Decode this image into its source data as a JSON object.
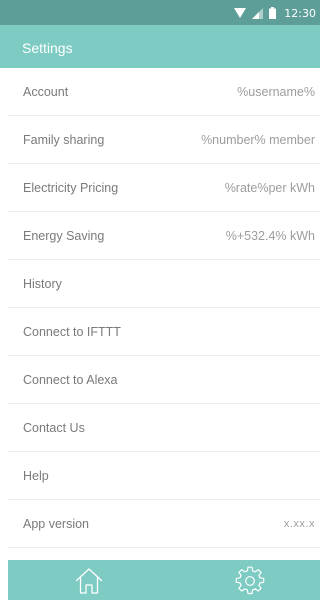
{
  "status_bar": {
    "time": "12:30",
    "icons": [
      "wifi-icon",
      "signal-icon",
      "battery-icon"
    ]
  },
  "header": {
    "title": "Settings"
  },
  "settings": {
    "items": [
      {
        "label": "Account",
        "value": "%username%"
      },
      {
        "label": "Family sharing",
        "value": "%number% member"
      },
      {
        "label": "Electricity Pricing",
        "value": "%rate%per kWh"
      },
      {
        "label": "Energy Saving",
        "value": "%+532.4% kWh"
      },
      {
        "label": "History",
        "value": ""
      },
      {
        "label": "Connect to IFTTT",
        "value": ""
      },
      {
        "label": "Connect to Alexa",
        "value": ""
      },
      {
        "label": "Contact Us",
        "value": ""
      },
      {
        "label": "Help",
        "value": ""
      },
      {
        "label": "App version",
        "value": "x.xx.x"
      }
    ]
  },
  "bottom_nav": {
    "items": [
      {
        "icon": "home-icon"
      },
      {
        "icon": "gear-icon"
      }
    ]
  },
  "colors": {
    "status_bar": "#5e9e99",
    "app_bar": "#7ecbc3",
    "bottom_nav": "#7ecbc3",
    "label_text": "#7a7a7a",
    "value_text": "#9d9d9d",
    "divider": "#ececec"
  }
}
